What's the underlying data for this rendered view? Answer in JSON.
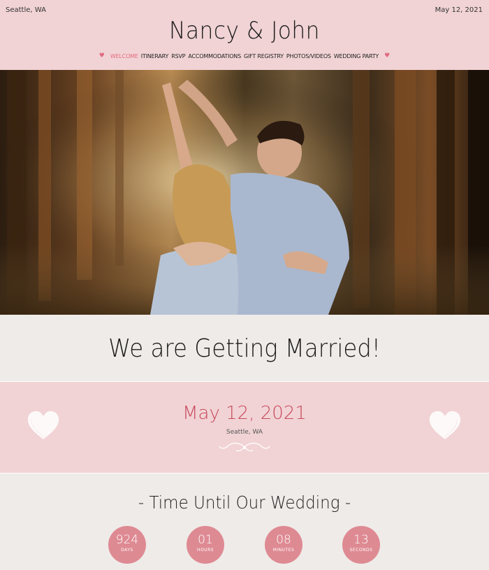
{
  "header": {
    "location": "Seattle, WA",
    "date": "May 12, 2021",
    "couple": "Nancy & John"
  },
  "nav": {
    "items": [
      {
        "label": "Welcome",
        "active": true
      },
      {
        "label": "Itinerary",
        "active": false
      },
      {
        "label": "RSVP",
        "active": false
      },
      {
        "label": "Accommodations",
        "active": false
      },
      {
        "label": "Gift Registry",
        "active": false
      },
      {
        "label": "Photos/Videos",
        "active": false
      },
      {
        "label": "Wedding Party",
        "active": false
      }
    ]
  },
  "hero": {
    "image": "couple-dancing-forest-photo"
  },
  "married": {
    "headline": "We are Getting Married!"
  },
  "event": {
    "date": "May 12, 2021",
    "city": "Seattle, WA"
  },
  "countdown": {
    "title": "- Time Until Our Wedding -",
    "days": {
      "value": "924",
      "unit": "Days"
    },
    "hours": {
      "value": "01",
      "unit": "Hours"
    },
    "minutes": {
      "value": "08",
      "unit": "Minutes"
    },
    "seconds": {
      "value": "13",
      "unit": "Seconds"
    }
  },
  "colors": {
    "pink_band": "#f1d3d5",
    "cream": "#efebe8",
    "accent": "#e56b7e",
    "circle": "#de8a93",
    "date_red": "#c84a5c"
  },
  "icons": [
    "heart-icon",
    "lace-heart-icon",
    "flourish-icon"
  ]
}
